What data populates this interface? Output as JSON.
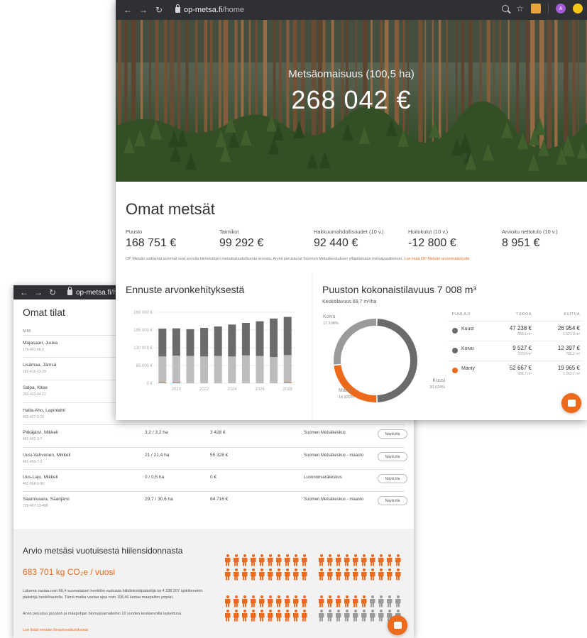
{
  "back": {
    "url_host": "op-metsa.fi",
    "url_path": "/home",
    "title": "Omat tilat",
    "table_header": "NIMI",
    "rows": [
      {
        "name": "Majasaari, Juuka",
        "id": "176-401-66-0"
      },
      {
        "name": "Lisämaa, Jämsä",
        "id": "182-416-13-29"
      },
      {
        "name": "Salpa, Kitee",
        "id": "260-433-44-22"
      },
      {
        "name": "Halla-Aho, Lapinlahti",
        "id": "402-427-9-19"
      },
      {
        "name": "Pitkäjärvi, Mikkeli",
        "id": "491-442-3-7",
        "area": "3,2 / 3,2 ha",
        "value": "3 428 €",
        "source": "Suomen Metsäkeskus",
        "btn": "Näytä tila"
      },
      {
        "name": "Uusi-Vahvonen, Mikkeli",
        "id": "491-450-7-3",
        "area": "21 / 21,4 ha",
        "value": "55 328 €",
        "source": "Suomen Metsäkeskus - maasto",
        "btn": "Näytä tila"
      },
      {
        "name": "Uus-Laju, Mikkeli",
        "id": "491-558-2-36",
        "area": "0 / 0,5 ha",
        "value": "0 €",
        "source": "Luonnonvarakeskus",
        "btn": "Näytä tila"
      },
      {
        "name": "Saarnivaara, Saarijärvi",
        "id": "729-407-13-496",
        "area": "29,7 / 30,6 ha",
        "value": "84 716 €",
        "source": "Suomen Metsäkeskus - maasto",
        "btn": "Näytä tila"
      }
    ],
    "carbon": {
      "title": "Arvio metsäsi vuotuisesta hiilensidonnasta",
      "amount": "683 701 kg CO₂e / vuosi",
      "p1": "Lukema vastaa noin 66,4 suomalaisen henkilön vuotuisia hiilidioksidipäästöjä tai 4 338 207 ajokilometrin päästöjä henkilöautolla. Tämä matka vastaa ajoa noin 108,46 kertaa maapallon ympäri.",
      "p2": "Arvio perustuu puuston ja maapohjan biomassamalleihin 10 vuoden keskiarvoilla laskettuna.",
      "link": "Lue lisää metsän ilmastovaikutuksista",
      "people_total": 80,
      "people_highlighted": 66,
      "highlight_color": "#ee6a1b",
      "rest_color": "#9a9a9a"
    }
  },
  "front": {
    "url_host": "op-metsa.fi",
    "url_path": "/home",
    "avatar_letter": "A",
    "hero_sub": "Metsäomaisuus (100,5 ha)",
    "hero_value": "268 042 €",
    "section_title": "Omat metsät",
    "kpis": [
      {
        "label": "Puusto",
        "value": "168 751 €"
      },
      {
        "label": "Taimikot",
        "value": "99 292 €"
      },
      {
        "label": "Hakkuumahdollisuudet (10 v.)",
        "value": "92 440 €"
      },
      {
        "label": "Hoitokulut (10 v.)",
        "value": "-12 800 €"
      },
      {
        "label": "Arvioitu nettotulo (10 v.)",
        "value": "8 951 €"
      }
    ],
    "disclaimer": "OP Metsän esittämät summat ovat arvioita kiinteistöjen metsätaloudellisesta arvosta. Arviot perustuvat Suomen Metsäkeskuksen ylläpitämään metsävaratietoon.",
    "disclaimer_link": "Lue lisää OP Metsän arvonmääritystä",
    "forecast_title": "Ennuste arvonkehityksestä",
    "volume_title": "Puuston kokonaistilavuus 7 008 m³",
    "volume_sub": "Keskitilavuus 69,7 m³/ha",
    "table_headers": {
      "species": "PUULAJI",
      "logs": "TUKKIA",
      "pulp": "KUITUA"
    },
    "species": [
      {
        "name": "Kuusi",
        "color": "#6b6b6b",
        "logs": "47 238 €",
        "logs_vol": "858,5 m³",
        "pulp": "26 954 €",
        "pulp_vol": "1 621,9 m³"
      },
      {
        "name": "Koivu",
        "color": "#6b6b6b",
        "logs": "9 527 €",
        "logs_vol": "220,8 m³",
        "pulp": "12 397 €",
        "pulp_vol": "795,2 m³"
      },
      {
        "name": "Mänty",
        "color": "#ee6a1b",
        "logs": "52 667 €",
        "logs_vol": "938,7 m³",
        "pulp": "19 965 €",
        "pulp_vol": "1 263,7 m³"
      }
    ],
    "donut_labels": {
      "koivu": "Koivu",
      "koivu_pct": "17,138%",
      "kuusi": "Kuusi",
      "kuusi_pct": "30,634%",
      "manty": "Mänty",
      "manty_pct": "14,929%"
    }
  },
  "chart_data": [
    {
      "type": "bar",
      "title": "Ennuste arvonkehityksestä",
      "stacked": true,
      "x": [
        2019,
        2020,
        2021,
        2022,
        2023,
        2024,
        2025,
        2026,
        2027,
        2028
      ],
      "tick_labels_x": [
        "2020",
        "2022",
        "2024",
        "2026",
        "2028"
      ],
      "tick_labels_y": [
        "0 €",
        "65 000 €",
        "130 000 €",
        "195 000 €",
        "260 000 €"
      ],
      "ylim": [
        0,
        260000
      ],
      "series": [
        {
          "color": "#ee6a1b",
          "values": [
            3000,
            3000,
            0,
            0,
            0,
            0,
            0,
            0,
            0,
            3000
          ]
        },
        {
          "color": "#bdbdbd",
          "values": [
            95000,
            98000,
            100000,
            98000,
            100000,
            98000,
            102000,
            100000,
            96000,
            100000
          ]
        },
        {
          "color": "#6b6b6b",
          "values": [
            102000,
            100000,
            98000,
            105000,
            108000,
            117000,
            119000,
            127000,
            141000,
            140000
          ]
        }
      ],
      "grid": true
    },
    {
      "type": "pie",
      "title": "Puuston kokonaistilavuus 7 008 m³",
      "donut": true,
      "segments": [
        {
          "label": "Kuusi",
          "value": 30.634,
          "color": "#6b6b6b"
        },
        {
          "label": "Koivu",
          "value": 17.138,
          "color": "#9a9a9a"
        },
        {
          "label": "Mänty",
          "value": 14.929,
          "color": "#ee6a1b"
        }
      ]
    }
  ]
}
